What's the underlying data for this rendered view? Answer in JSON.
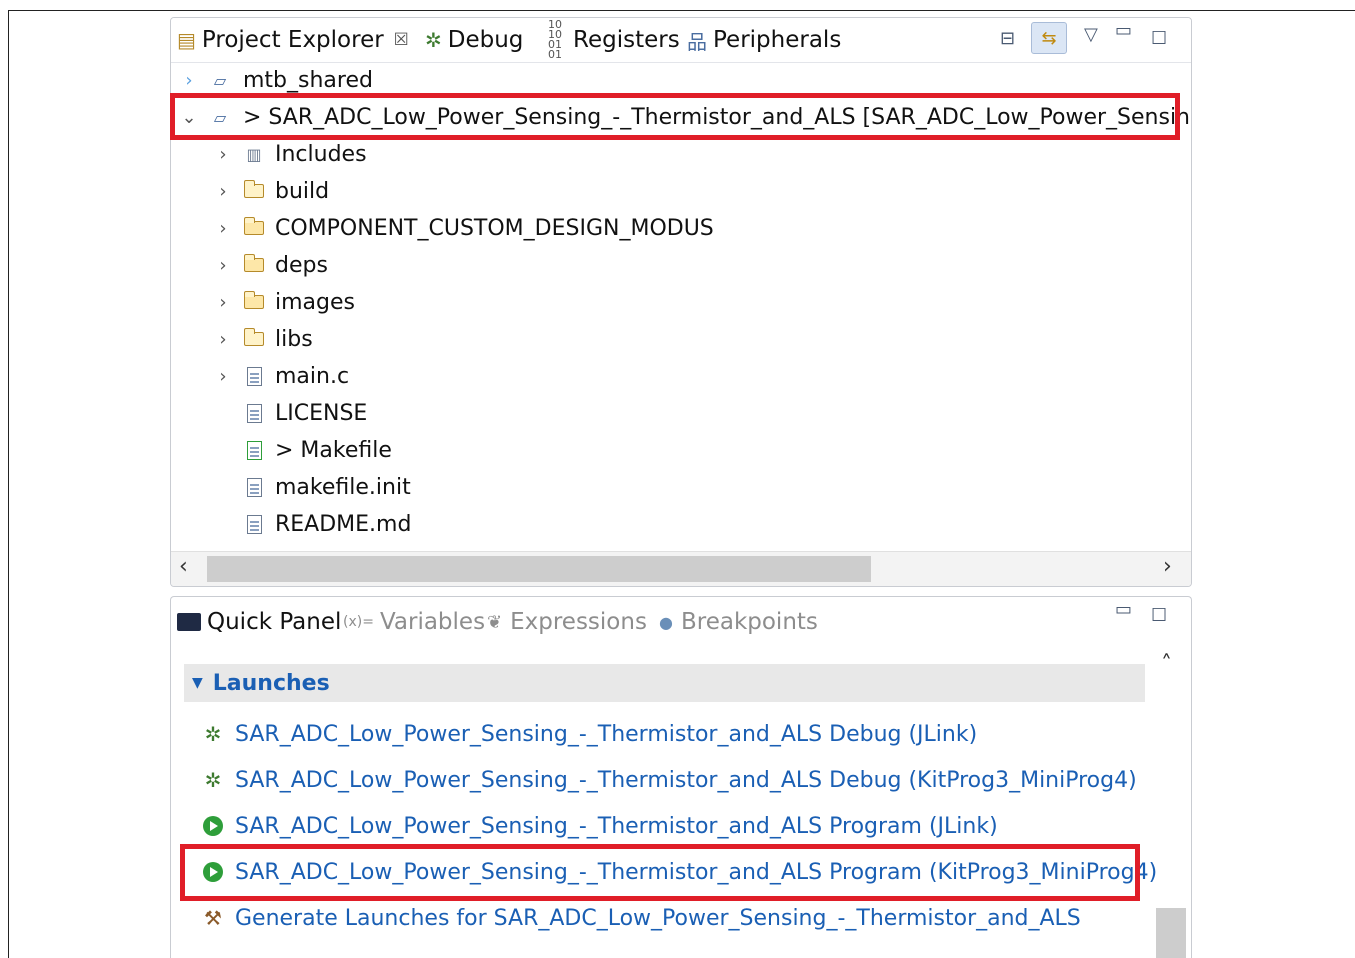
{
  "project_explorer": {
    "tabs": [
      {
        "label": "Project Explorer",
        "icon": "project-explorer-icon"
      },
      {
        "label": "Debug",
        "icon": "debug-bug-icon"
      },
      {
        "label": "Registers",
        "icon": "registers-icon"
      },
      {
        "label": "Peripherals",
        "icon": "peripherals-icon"
      }
    ],
    "close_glyph": "☒",
    "toolbar_icons": [
      "collapse-all-icon",
      "link-with-editor-icon",
      "view-menu-icon",
      "minimize-icon",
      "maximize-icon"
    ],
    "tree": [
      {
        "label": "mtb_shared",
        "icon": "shared-project-icon",
        "expanded": false
      },
      {
        "label": "> SAR_ADC_Low_Power_Sensing_-_Thermistor_and_ALS [SAR_ADC_Low_Power_Sensing_",
        "icon": "project-icon",
        "expanded": true
      },
      {
        "label": "Includes",
        "icon": "includes-icon"
      },
      {
        "label": "build",
        "icon": "folder-icon"
      },
      {
        "label": "COMPONENT_CUSTOM_DESIGN_MODUS",
        "icon": "source-folder-icon"
      },
      {
        "label": "deps",
        "icon": "source-folder-icon"
      },
      {
        "label": "images",
        "icon": "source-folder-icon"
      },
      {
        "label": "libs",
        "icon": "folder-icon"
      },
      {
        "label": "main.c",
        "icon": "c-file-icon"
      },
      {
        "label": "LICENSE",
        "icon": "text-file-icon"
      },
      {
        "label": "> Makefile",
        "icon": "makefile-icon"
      },
      {
        "label": "makefile.init",
        "icon": "file-icon"
      },
      {
        "label": "README.md",
        "icon": "markdown-file-icon"
      }
    ]
  },
  "quick_panel": {
    "tabs": [
      {
        "label": "Quick Panel",
        "icon": "quick-panel-icon",
        "active": true
      },
      {
        "label": "Variables",
        "icon": "variables-icon",
        "prefix": "(x)="
      },
      {
        "label": "Expressions",
        "icon": "expressions-icon"
      },
      {
        "label": "Breakpoints",
        "icon": "breakpoints-icon"
      }
    ],
    "section_title": "Launches",
    "launches": [
      {
        "label": "SAR_ADC_Low_Power_Sensing_-_Thermistor_and_ALS Debug (JLink)",
        "icon": "debug-bug-icon"
      },
      {
        "label": "SAR_ADC_Low_Power_Sensing_-_Thermistor_and_ALS Debug (KitProg3_MiniProg4)",
        "icon": "debug-bug-icon"
      },
      {
        "label": "SAR_ADC_Low_Power_Sensing_-_Thermistor_and_ALS Program (JLink)",
        "icon": "run-play-icon"
      },
      {
        "label": "SAR_ADC_Low_Power_Sensing_-_Thermistor_and_ALS Program (KitProg3_MiniProg4)",
        "icon": "run-play-icon"
      },
      {
        "label": "Generate Launches for SAR_ADC_Low_Power_Sensing_-_Thermistor_and_ALS",
        "icon": "hammer-icon"
      }
    ]
  },
  "colors": {
    "highlight": "#e01e28",
    "link": "#1a5fb4",
    "section_bg": "#e8e8e8"
  }
}
